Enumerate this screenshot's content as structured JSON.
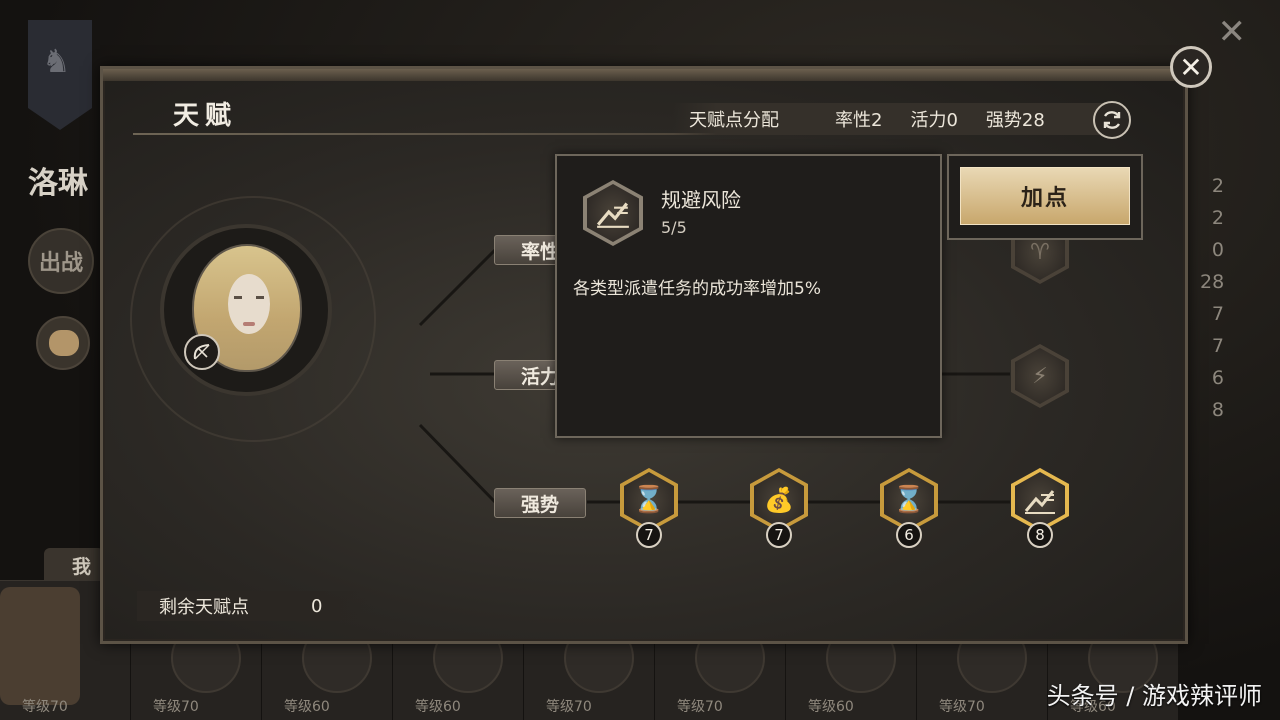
{
  "background": {
    "side_title": "洛琳",
    "sortie_label": "出战",
    "me_tab": "我",
    "right_numbers": [
      "2",
      "2",
      "0",
      "28",
      "7",
      "7",
      "6",
      "8"
    ],
    "heroes": [
      {
        "level": "等级70"
      },
      {
        "level": "等级70"
      },
      {
        "level": "等级60"
      },
      {
        "level": "等级60"
      },
      {
        "level": "等级70"
      },
      {
        "level": "等级70"
      },
      {
        "level": "等级60"
      },
      {
        "level": "等级70"
      },
      {
        "level": "等级60"
      }
    ]
  },
  "panel": {
    "title": "天赋",
    "stats": {
      "distribution_label": "天赋点分配",
      "lvl1": "率性2",
      "lvl2": "活力0",
      "lvl3": "强势28"
    },
    "categories": {
      "c1": "率性",
      "c2": "活力",
      "c3": "强势"
    },
    "nodes_row3": [
      {
        "icon": "hourglass-icon",
        "count": "7"
      },
      {
        "icon": "money-bag-plus-icon",
        "count": "7"
      },
      {
        "icon": "hourglass-down-icon",
        "count": "6"
      },
      {
        "icon": "risk-avoid-icon",
        "count": "8"
      }
    ],
    "remaining_label": "剩余天赋点",
    "remaining_value": "0"
  },
  "tooltip": {
    "name": "规避风险",
    "level": "5/5",
    "description": "各类型派遣任务的成功率增加5%"
  },
  "add_point_button": "加点",
  "watermark": "头条号 / 游戏辣评师",
  "colors": {
    "gold": "#c79a3c",
    "selected_gold": "#e5b84f",
    "panel_border": "#5c5346"
  }
}
